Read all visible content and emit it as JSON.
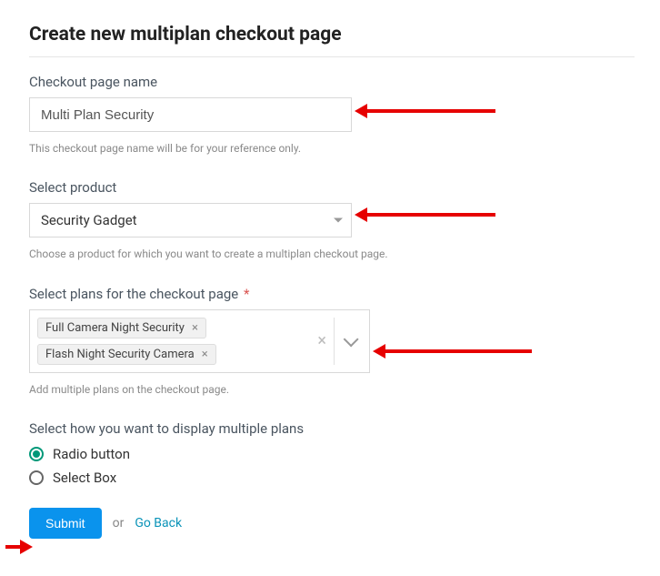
{
  "page": {
    "title": "Create new multiplan checkout page"
  },
  "fields": {
    "name": {
      "label": "Checkout page name",
      "value": "Multi Plan Security",
      "helper": "This checkout page name will be for your reference only."
    },
    "product": {
      "label": "Select product",
      "value": "Security Gadget",
      "helper": "Choose a product for which you want to create a multiplan checkout page."
    },
    "plans": {
      "label": "Select plans for the checkout page",
      "required_mark": "*",
      "chips": [
        "Full Camera Night Security",
        "Flash Night Security Camera"
      ],
      "helper": "Add multiple plans on the checkout page."
    },
    "display": {
      "label": "Select how you want to display multiple plans",
      "options": [
        {
          "label": "Radio button",
          "checked": true
        },
        {
          "label": "Select Box",
          "checked": false
        }
      ]
    }
  },
  "actions": {
    "submit": "Submit",
    "or": "or",
    "go_back": "Go Back"
  }
}
